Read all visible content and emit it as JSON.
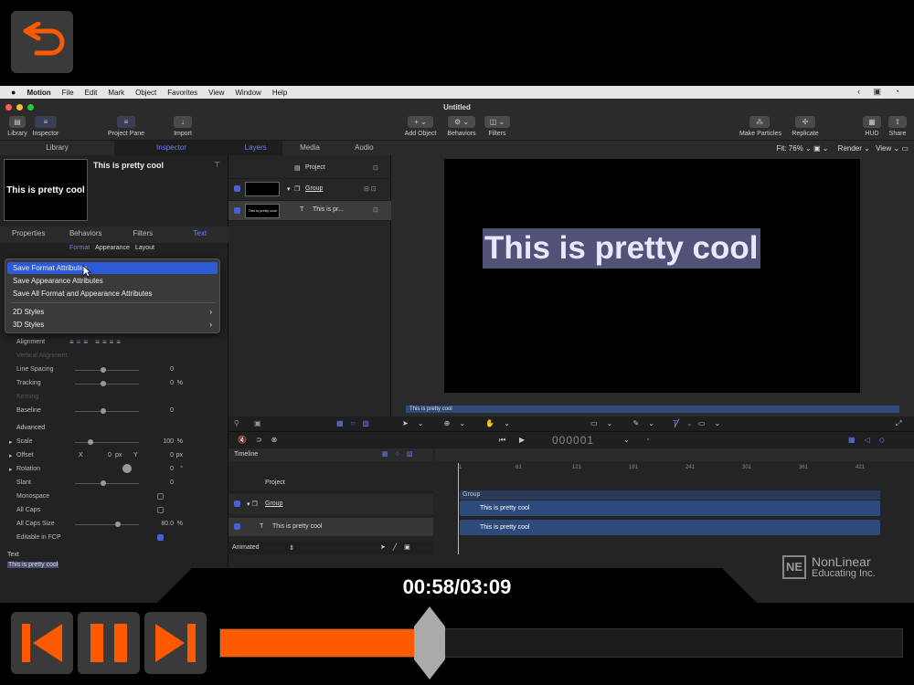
{
  "overlay": {
    "time": "00:58/03:09",
    "progress": 0.307,
    "accent": "#ff5a00"
  },
  "menubar": {
    "app": "Motion",
    "items": [
      "File",
      "Edit",
      "Mark",
      "Object",
      "Favorites",
      "View",
      "Window",
      "Help"
    ]
  },
  "window": {
    "title": "Untitled",
    "toolbar": {
      "library": "Library",
      "inspector": "Inspector",
      "project_pane": "Project Pane",
      "import": "Import",
      "add_object": "Add Object",
      "behaviors": "Behaviors",
      "filters": "Filters",
      "make_particles": "Make Particles",
      "replicate": "Replicate",
      "hud": "HUD",
      "share": "Share"
    }
  },
  "left_panel": {
    "tabs": [
      "Library",
      "Inspector"
    ],
    "preview_text": "This is pretty cool",
    "preview_name": "This is pretty cool",
    "sub_tabs": [
      "Properties",
      "Behaviors",
      "Filters",
      "Text"
    ],
    "text_tabs": [
      "Format",
      "Appearance",
      "Layout"
    ],
    "menu": {
      "items": [
        "Save Format Attributes",
        "Save Appearance Attributes",
        "Save All Format and Appearance Attributes"
      ],
      "submenus": [
        "2D Styles",
        "3D Styles"
      ]
    },
    "props": {
      "alignment": "Alignment",
      "vertical_alignment": "Vertical Alignment",
      "line_spacing": "Line Spacing",
      "line_spacing_val": "0",
      "tracking": "Tracking",
      "tracking_val": "0",
      "tracking_unit": "%",
      "kerning": "Kerning",
      "baseline": "Baseline",
      "baseline_val": "0",
      "advanced": "Advanced",
      "scale": "Scale",
      "scale_val": "100",
      "scale_unit": "%",
      "offset": "Offset",
      "offset_x_lbl": "X",
      "offset_x": "0",
      "offset_x_unit": "px",
      "offset_y_lbl": "Y",
      "offset_y": "0",
      "offset_y_unit": "px",
      "rotation": "Rotation",
      "rotation_val": "0",
      "rotation_unit": "°",
      "slant": "Slant",
      "slant_val": "0",
      "monospace": "Monospace",
      "all_caps": "All Caps",
      "all_caps_size": "All Caps Size",
      "all_caps_size_val": "80.0",
      "all_caps_size_unit": "%",
      "editable_fcp": "Editable in FCP",
      "text_label": "Text",
      "text_value": "This is pretty cool"
    }
  },
  "layers_panel": {
    "tabs": [
      "Layers",
      "Media",
      "Audio"
    ],
    "project": "Project",
    "group": "Group",
    "layer": "This is pr...",
    "thumb_text": "This is pretty cool"
  },
  "canvas": {
    "fit": "Fit: 76%",
    "render": "Render",
    "view": "View",
    "text": "This is pretty cool",
    "mini_track": "This is pretty cool"
  },
  "timeline": {
    "title": "Timeline",
    "timecode": "000001",
    "project": "Project",
    "group": "Group",
    "layer": "This is pretty cool",
    "track_group": "Group",
    "track1": "This is pretty cool",
    "track2": "This is pretty cool",
    "ruler": [
      "1",
      "61",
      "121",
      "181",
      "241",
      "301",
      "361",
      "421"
    ],
    "animated": "Animated"
  },
  "watermark": {
    "line1": "NonLinear",
    "line2": "Educating Inc."
  }
}
